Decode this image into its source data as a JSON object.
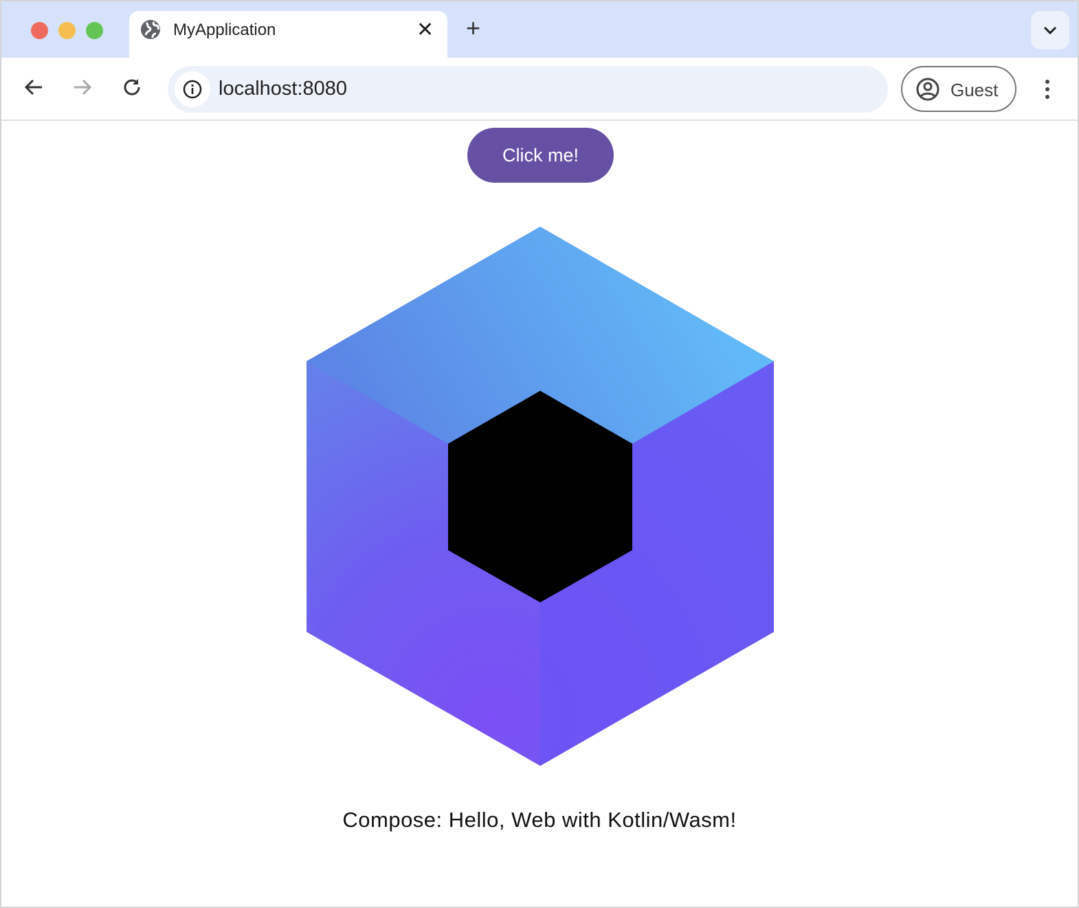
{
  "browser": {
    "tab_title": "MyApplication",
    "url": "localhost:8080",
    "profile_label": "Guest",
    "colors": {
      "tabstrip": "#d6e2fb",
      "omnibox": "#edf2fa"
    }
  },
  "page": {
    "button_label": "Click me!",
    "caption": "Compose: Hello, Web with Kotlin/Wasm!",
    "colors": {
      "button": "#6650a4",
      "logo_top": "#62b7f7",
      "logo_side": "#6a55f5",
      "logo_center": "#000000"
    }
  }
}
